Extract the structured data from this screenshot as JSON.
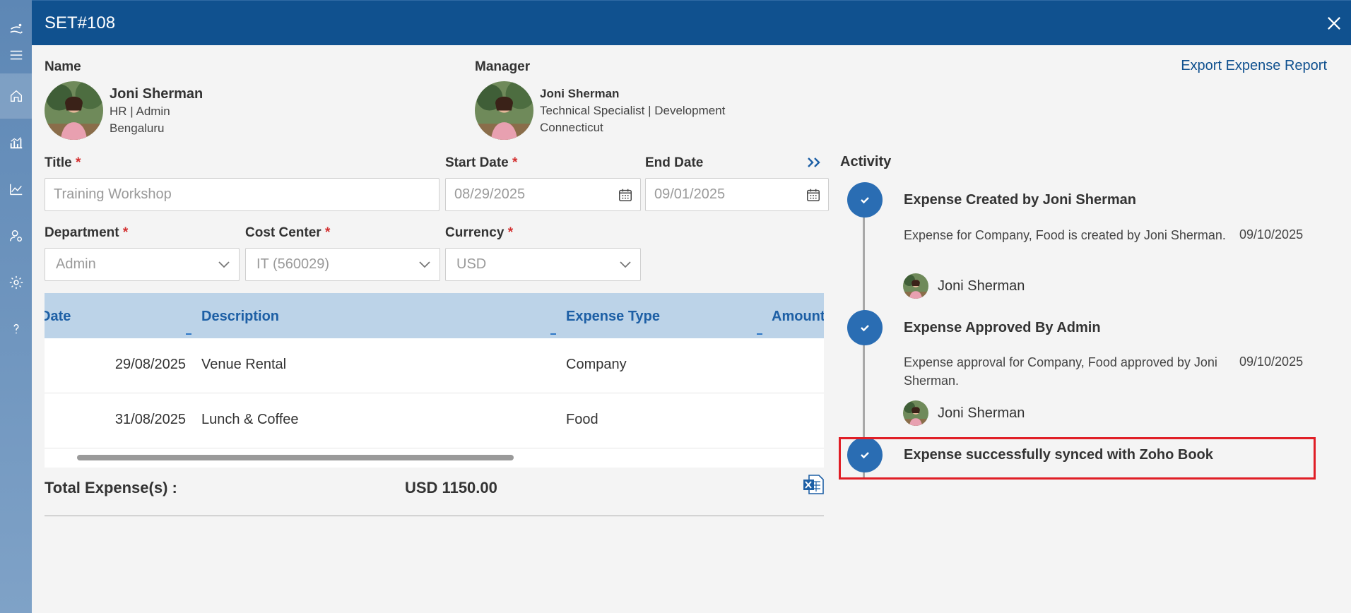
{
  "header": {
    "title": "SET#108"
  },
  "employee": {
    "label": "Name",
    "name": "Joni Sherman",
    "role": "HR | Admin",
    "location": "Bengaluru"
  },
  "manager": {
    "label": "Manager",
    "name": "Joni Sherman",
    "role": "Technical Specialist | Development",
    "location": "Connecticut"
  },
  "export_link": "Export Expense Report",
  "form": {
    "title_label": "Title",
    "title_placeholder": "Training Workshop",
    "start_date_label": "Start Date",
    "start_date": "08/29/2025",
    "end_date_label": "End Date",
    "end_date": "09/01/2025",
    "department_label": "Department",
    "department": "Admin",
    "cost_center_label": "Cost Center",
    "cost_center": "IT (560029)",
    "currency_label": "Currency",
    "currency": "USD",
    "required_mark": "*"
  },
  "table": {
    "headers": [
      "Date",
      "Description",
      "Expense Type",
      "Amount"
    ],
    "rows": [
      {
        "date": "29/08/2025",
        "description": "Venue Rental",
        "type": "Company"
      },
      {
        "date": "31/08/2025",
        "description": "Lunch & Coffee",
        "type": "Food"
      }
    ]
  },
  "total": {
    "label": "Total Expense(s) :",
    "value": "USD 1150.00"
  },
  "activity": {
    "title": "Activity",
    "steps": [
      {
        "title": "Expense Created by Joni Sherman",
        "description": "Expense for Company, Food is created by Joni Sherman.",
        "date": "09/10/2025",
        "user": "Joni Sherman"
      },
      {
        "title": "Expense Approved By Admin",
        "description": "Expense approval for Company, Food approved by Joni Sherman.",
        "date": "09/10/2025",
        "user": "Joni Sherman"
      },
      {
        "title": "Expense successfully synced with Zoho Book"
      }
    ]
  },
  "colors": {
    "header_bg": "#10518f",
    "accent": "#2a6db3",
    "table_header_bg": "#bcd3e8",
    "highlight": "#e01e26",
    "required": "#d32f2f"
  },
  "sidebar_icons": [
    "logo-icon",
    "menu-icon",
    "home-icon",
    "bar-chart-icon",
    "line-chart-icon",
    "user-settings-icon",
    "gear-icon",
    "help-icon"
  ]
}
